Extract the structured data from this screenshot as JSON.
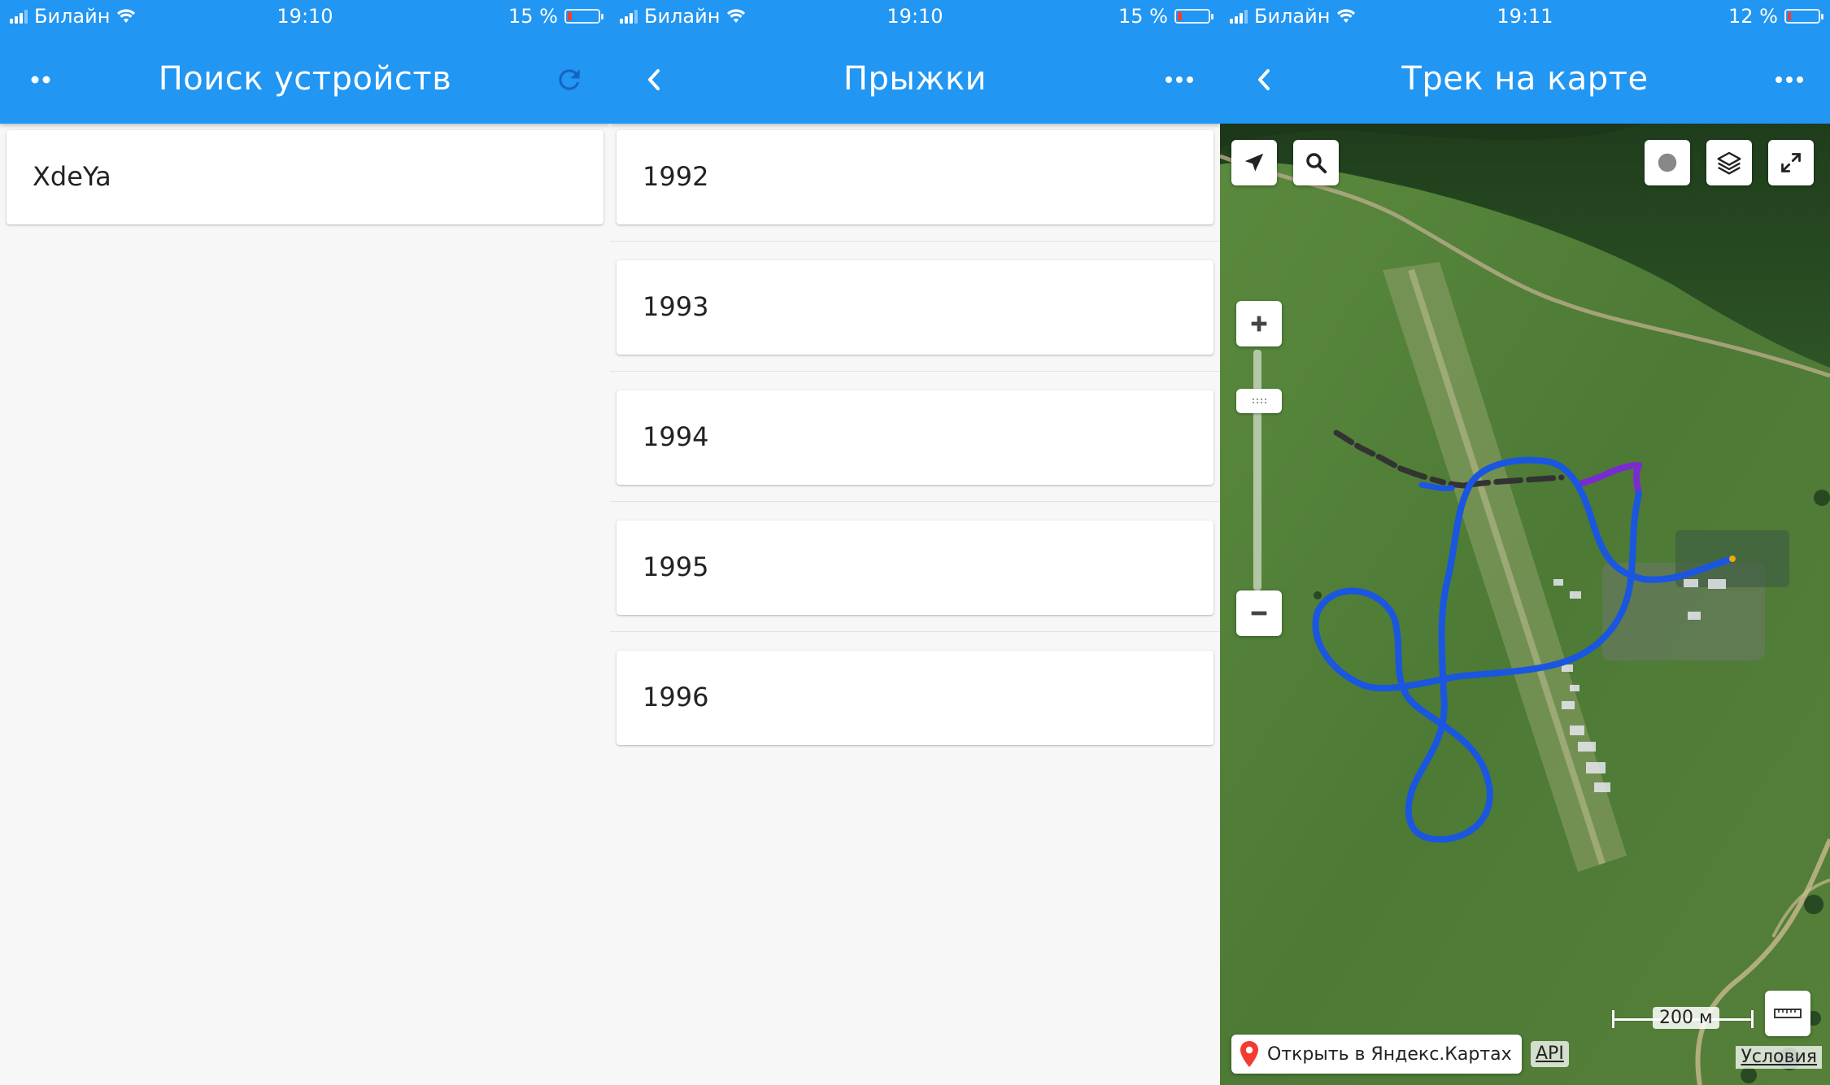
{
  "screen1": {
    "status": {
      "carrier": "Билайн",
      "time": "19:10",
      "battery": "15 %",
      "battery_level": 0.15
    },
    "header": {
      "title": "Поиск устройств",
      "left_icon": "two-dots-icon",
      "right_icon": "refresh-icon"
    },
    "devices": [
      {
        "name": "XdeYa"
      }
    ]
  },
  "screen2": {
    "status": {
      "carrier": "Билайн",
      "time": "19:10",
      "battery": "15 %",
      "battery_level": 0.15
    },
    "header": {
      "title": "Прыжки",
      "left_icon": "back-chevron-icon",
      "right_icon": "more-icon"
    },
    "jumps": [
      {
        "label": "1992"
      },
      {
        "label": "1993"
      },
      {
        "label": "1994"
      },
      {
        "label": "1995"
      },
      {
        "label": "1996"
      }
    ]
  },
  "screen3": {
    "status": {
      "carrier": "Билайн",
      "time": "19:11",
      "battery": "12 %",
      "battery_level": 0.12
    },
    "header": {
      "title": "Трек на карте",
      "left_icon": "back-chevron-icon",
      "right_icon": "more-icon"
    },
    "map": {
      "scale_label": "200 м",
      "open_label": "Открыть в Яндекс.Картах",
      "api_label": "API",
      "terms_label": "Условия",
      "track_colors": {
        "ground": "#333333",
        "flight": "#1a56e0",
        "transition": "#7a2bd0"
      }
    }
  },
  "colors": {
    "header": "#2196f3",
    "accent_refresh": "#1565c0",
    "map_grass": "#4f7a36"
  }
}
